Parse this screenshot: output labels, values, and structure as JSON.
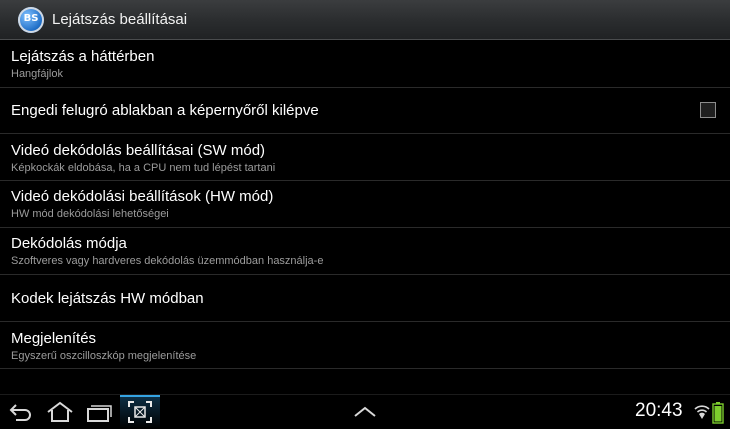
{
  "app": {
    "icon_name": "bs-player-icon",
    "icon_text": "BS",
    "title": "Lejátszás beállításai"
  },
  "settings": [
    {
      "title": "Lejátszás a háttérben",
      "subtitle": "Hangfájlok"
    },
    {
      "title": "Engedi felugró ablakban a képernyőről kilépve",
      "subtitle": "",
      "checkbox": true,
      "checked": false
    },
    {
      "title": "Videó dekódolás beállításai (SW mód)",
      "subtitle": "Képkockák eldobása, ha a CPU nem tud lépést tartani"
    },
    {
      "title": "Videó dekódolási beállítások (HW mód)",
      "subtitle": "HW mód dekódolási lehetőségei"
    },
    {
      "title": "Dekódolás módja",
      "subtitle": "Szoftveres vagy hardveres dekódolás üzemmódban használja-e"
    },
    {
      "title": "Kodek lejátszás HW módban",
      "subtitle": ""
    },
    {
      "title": "Megjelenítés",
      "subtitle": "Egyszerű oszcilloszkóp megjelenítése"
    }
  ],
  "navbar": {
    "icons": [
      "back-icon",
      "home-icon",
      "recent-apps-icon",
      "screenshot-icon",
      "expand-up-icon"
    ],
    "time": "20:43",
    "status_icons": [
      "wifi-icon",
      "battery-icon"
    ],
    "accent_color": "#35a4e3",
    "battery_color": "#7ccc2d"
  }
}
